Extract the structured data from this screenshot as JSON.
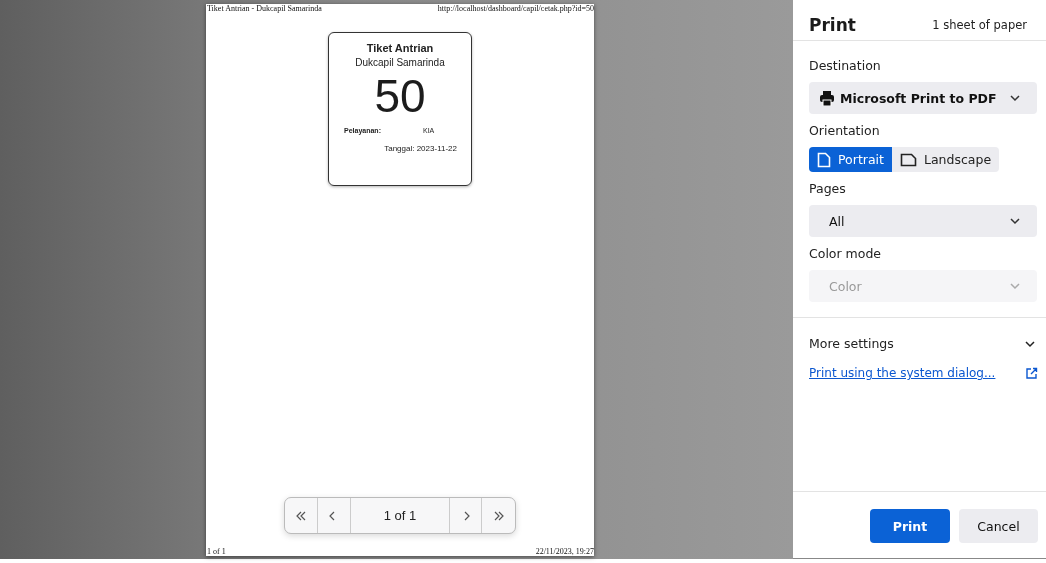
{
  "preview": {
    "page": {
      "header_left": "Tiket Antrian - Dukcapil Samarinda",
      "header_right": "http://localhost/dashboard/capil/cetak.php?id=50",
      "footer_left": "1 of 1",
      "footer_right": "22/11/2023, 19:27",
      "ticket": {
        "title": "Tiket Antrian",
        "subtitle": "Dukcapil Samarinda",
        "number": "50",
        "service_label": "Pelayanan:",
        "service_value": "KIA",
        "date": "Tanggal: 2023-11-22"
      }
    },
    "pager": {
      "label": "1 of 1"
    }
  },
  "panel": {
    "title": "Print",
    "sheets": "1 sheet of paper",
    "settings": [
      {
        "kind": "destination",
        "label": "Destination",
        "value": "Microsoft Print to PDF",
        "disabled": false
      },
      {
        "kind": "segmented",
        "label": "Orientation",
        "options": [
          {
            "label": "Portrait",
            "selected": true
          },
          {
            "label": "Landscape",
            "selected": false
          }
        ]
      },
      {
        "kind": "select",
        "label": "Pages",
        "value": "All",
        "disabled": false
      },
      {
        "kind": "select",
        "label": "Color mode",
        "value": "Color",
        "disabled": true
      }
    ],
    "more_settings": {
      "label": "More settings",
      "expanded": false
    },
    "system_dialog_link": "Print using the system dialog...",
    "buttons": [
      {
        "label": "Print",
        "kind": "primary"
      },
      {
        "label": "Cancel",
        "kind": "secondary"
      }
    ]
  }
}
